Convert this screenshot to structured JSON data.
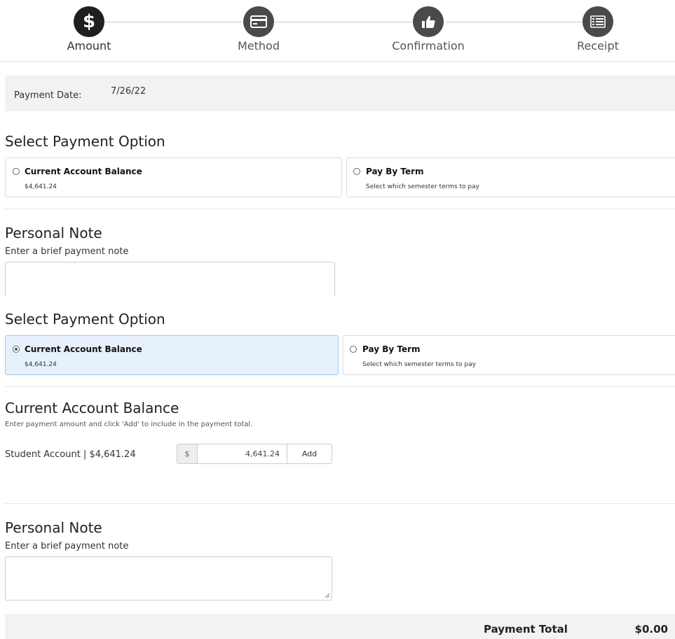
{
  "stepper": {
    "steps": [
      {
        "label": "Amount",
        "icon": "dollar-icon"
      },
      {
        "label": "Method",
        "icon": "credit-card-icon"
      },
      {
        "label": "Confirmation",
        "icon": "thumbs-up-icon"
      },
      {
        "label": "Receipt",
        "icon": "list-icon"
      }
    ],
    "active_index": 0
  },
  "payment_date": {
    "label": "Payment Date:",
    "value": "7/26/22"
  },
  "section1": {
    "title": "Select Payment Option",
    "options": [
      {
        "title": "Current Account Balance",
        "subtitle": "$4,641.24",
        "selected": false
      },
      {
        "title": "Pay By Term",
        "subtitle": "Select which semester terms to pay",
        "selected": false
      }
    ]
  },
  "note1": {
    "title": "Personal Note",
    "prompt": "Enter a brief payment note",
    "value": ""
  },
  "section2": {
    "title": "Select Payment Option",
    "options": [
      {
        "title": "Current Account Balance",
        "subtitle": "$4,641.24",
        "selected": true
      },
      {
        "title": "Pay By Term",
        "subtitle": "Select which semester terms to pay",
        "selected": false
      }
    ]
  },
  "balance": {
    "title": "Current Account Balance",
    "instructions": "Enter payment amount and click 'Add' to include in the payment total.",
    "account_label": "Student Account | $4,641.24",
    "currency_symbol": "$",
    "amount_value": "4,641.24",
    "add_label": "Add"
  },
  "note2": {
    "title": "Personal Note",
    "prompt": "Enter a brief payment note",
    "value": ""
  },
  "total": {
    "label": "Payment Total",
    "value": "$0.00"
  },
  "colors": {
    "selected_bg": "#e6f1fc",
    "selected_border": "#9cc7ee",
    "step_icon": "#4a4a4a"
  }
}
